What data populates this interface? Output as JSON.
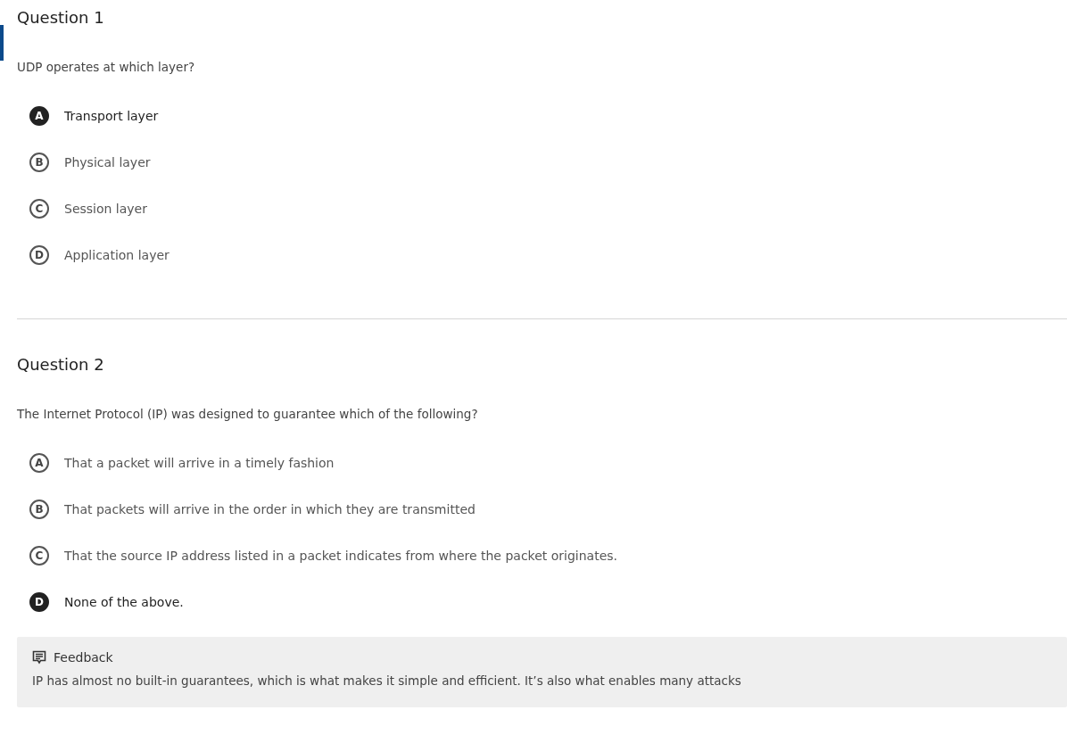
{
  "questions": [
    {
      "title": "Question 1",
      "current": true,
      "prompt": "UDP operates at which layer?",
      "options": [
        {
          "letter": "A",
          "text": "Transport layer",
          "selected": true
        },
        {
          "letter": "B",
          "text": "Physical layer",
          "selected": false
        },
        {
          "letter": "C",
          "text": "Session layer",
          "selected": false
        },
        {
          "letter": "D",
          "text": "Application layer",
          "selected": false
        }
      ]
    },
    {
      "title": "Question 2",
      "current": false,
      "prompt": "The Internet Protocol (IP) was designed to guarantee which of the following?",
      "options": [
        {
          "letter": "A",
          "text": "That a packet will arrive in a timely fashion",
          "selected": false
        },
        {
          "letter": "B",
          "text": "That packets will arrive in the order in which they are transmitted",
          "selected": false
        },
        {
          "letter": "C",
          "text": "That the source IP address listed in a packet indicates from where the packet originates.",
          "selected": false
        },
        {
          "letter": "D",
          "text": "None of the above.",
          "selected": true
        }
      ],
      "feedback": {
        "title": "Feedback",
        "text": "IP has almost no built-in guarantees, which is what makes it simple and efficient. It’s also what enables many attacks"
      }
    }
  ]
}
